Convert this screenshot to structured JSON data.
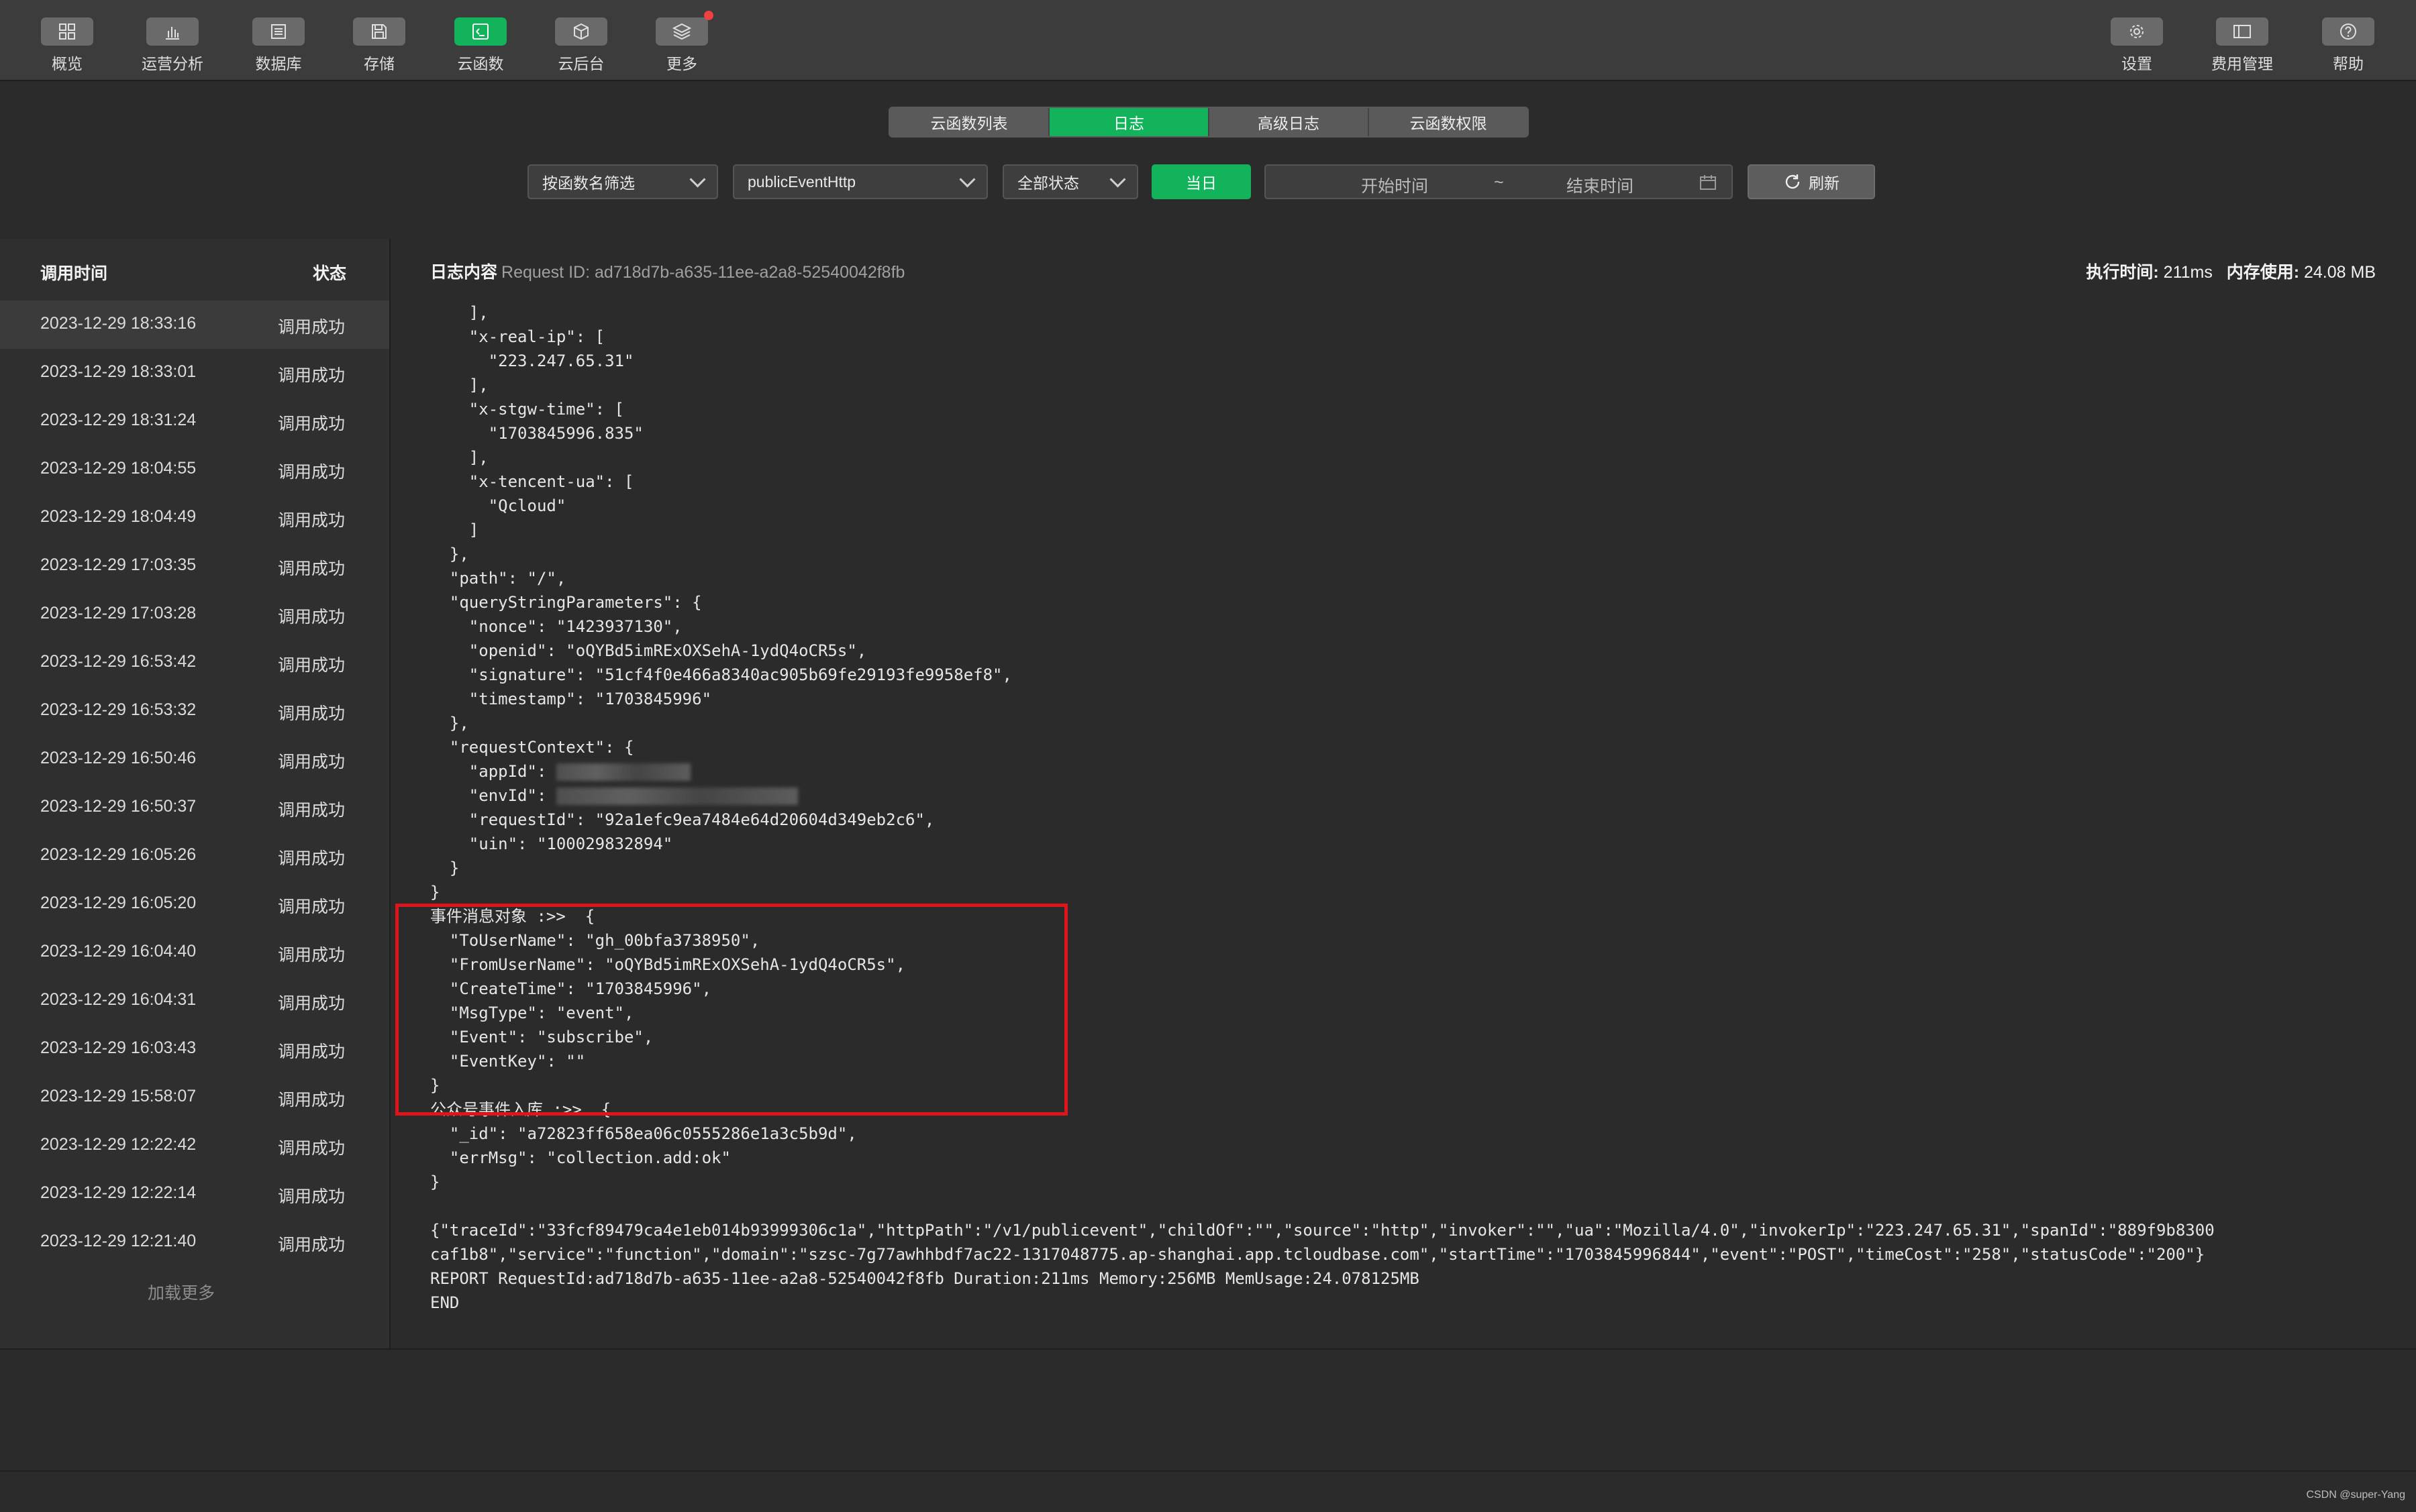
{
  "toolbar": {
    "left_items": [
      {
        "label": "概览",
        "icon": "grid-icon"
      },
      {
        "label": "运营分析",
        "icon": "bar-chart-icon"
      },
      {
        "label": "数据库",
        "icon": "database-icon"
      },
      {
        "label": "存储",
        "icon": "storage-icon"
      },
      {
        "label": "云函数",
        "icon": "cloud-function-icon",
        "active": true
      },
      {
        "label": "云后台",
        "icon": "cube-icon"
      },
      {
        "label": "更多",
        "icon": "layers-icon"
      }
    ],
    "right_items": [
      {
        "label": "设置",
        "icon": "gear-icon"
      },
      {
        "label": "费用管理",
        "icon": "billing-icon"
      },
      {
        "label": "帮助",
        "icon": "help-icon"
      }
    ]
  },
  "tabs": [
    {
      "label": "云函数列表"
    },
    {
      "label": "日志",
      "active": true
    },
    {
      "label": "高级日志"
    },
    {
      "label": "云函数权限"
    }
  ],
  "filters": {
    "function_filter": "按函数名筛选",
    "function_name": "publicEventHttp",
    "status": "全部状态",
    "today_button": "当日",
    "start_time_placeholder": "开始时间",
    "range_separator": "~",
    "end_time_placeholder": "结束时间",
    "refresh_button": "刷新"
  },
  "invocation_list": {
    "col_time": "调用时间",
    "col_status": "状态",
    "rows": [
      {
        "time": "2023-12-29 18:33:16",
        "status": "调用成功"
      },
      {
        "time": "2023-12-29 18:33:01",
        "status": "调用成功"
      },
      {
        "time": "2023-12-29 18:31:24",
        "status": "调用成功"
      },
      {
        "time": "2023-12-29 18:04:55",
        "status": "调用成功"
      },
      {
        "time": "2023-12-29 18:04:49",
        "status": "调用成功"
      },
      {
        "time": "2023-12-29 17:03:35",
        "status": "调用成功"
      },
      {
        "time": "2023-12-29 17:03:28",
        "status": "调用成功"
      },
      {
        "time": "2023-12-29 16:53:42",
        "status": "调用成功"
      },
      {
        "time": "2023-12-29 16:53:32",
        "status": "调用成功"
      },
      {
        "time": "2023-12-29 16:50:46",
        "status": "调用成功"
      },
      {
        "time": "2023-12-29 16:50:37",
        "status": "调用成功"
      },
      {
        "time": "2023-12-29 16:05:26",
        "status": "调用成功"
      },
      {
        "time": "2023-12-29 16:05:20",
        "status": "调用成功"
      },
      {
        "time": "2023-12-29 16:04:40",
        "status": "调用成功"
      },
      {
        "time": "2023-12-29 16:04:31",
        "status": "调用成功"
      },
      {
        "time": "2023-12-29 16:03:43",
        "status": "调用成功"
      },
      {
        "time": "2023-12-29 15:58:07",
        "status": "调用成功"
      },
      {
        "time": "2023-12-29 12:22:42",
        "status": "调用成功"
      },
      {
        "time": "2023-12-29 12:22:14",
        "status": "调用成功"
      },
      {
        "time": "2023-12-29 12:21:40",
        "status": "调用成功"
      }
    ],
    "load_more": "加载更多"
  },
  "log": {
    "heading": "日志内容",
    "request_id": "Request ID: ad718d7b-a635-11ee-a2a8-52540042f8fb",
    "exec_time_label": "执行时间:",
    "exec_time_value": "211ms",
    "memory_label": "内存使用:",
    "memory_value": "24.08 MB",
    "lines": {
      "l01": "    ],",
      "l02": "    \"x-real-ip\": [",
      "l03": "      \"223.247.65.31\"",
      "l04": "    ],",
      "l05": "    \"x-stgw-time\": [",
      "l06": "      \"1703845996.835\"",
      "l07": "    ],",
      "l08": "    \"x-tencent-ua\": [",
      "l09": "      \"Qcloud\"",
      "l10": "    ]",
      "l11": "  },",
      "l12": "  \"path\": \"/\",",
      "l13": "  \"queryStringParameters\": {",
      "l14": "    \"nonce\": \"1423937130\",",
      "l15": "    \"openid\": \"oQYBd5imRExOXSehA-1ydQ4oCR5s\",",
      "l16": "    \"signature\": \"51cf4f0e466a8340ac905b69fe29193fe9958ef8\",",
      "l17": "    \"timestamp\": \"1703845996\"",
      "l18": "  },",
      "l19": "  \"requestContext\": {",
      "l20a": "    \"appId\": ",
      "l21a": "    \"envId\": ",
      "l22": "    \"requestId\": \"92a1efc9ea7484e64d20604d349eb2c6\",",
      "l23": "    \"uin\": \"100029832894\"",
      "l24": "  }",
      "l25": "}",
      "l26": "事件消息对象 :>>  {",
      "l27": "  \"ToUserName\": \"gh_00bfa3738950\",",
      "l28": "  \"FromUserName\": \"oQYBd5imRExOXSehA-1ydQ4oCR5s\",",
      "l29": "  \"CreateTime\": \"1703845996\",",
      "l30": "  \"MsgType\": \"event\",",
      "l31": "  \"Event\": \"subscribe\",",
      "l32": "  \"EventKey\": \"\"",
      "l33": "}",
      "l34": "公众号事件入库 :>>  {",
      "l35": "  \"_id\": \"a72823ff658ea06c0555286e1a3c5b9d\",",
      "l36": "  \"errMsg\": \"collection.add:ok\"",
      "l37": "}",
      "l38": "",
      "l39": "{\"traceId\":\"33fcf89479ca4e1eb014b93999306c1a\",\"httpPath\":\"/v1/publicevent\",\"childOf\":\"\",\"source\":\"http\",\"invoker\":\"\",\"ua\":\"Mozilla/4.0\",\"invokerIp\":\"223.247.65.31\",\"spanId\":\"889f9b8300",
      "l40": "caf1b8\",\"service\":\"function\",\"domain\":\"szsc-7g77awhhbdf7ac22-1317048775.ap-shanghai.app.tcloudbase.com\",\"startTime\":\"1703845996844\",\"event\":\"POST\",\"timeCost\":\"258\",\"statusCode\":\"200\"}",
      "l41": "REPORT RequestId:ad718d7b-a635-11ee-a2a8-52540042f8fb Duration:211ms Memory:256MB MemUsage:24.078125MB",
      "l42": "END"
    }
  },
  "watermark": "CSDN @super-Yang",
  "colors": {
    "accent_green": "#12b35a",
    "highlight_red": "#e0141b",
    "background": "#2b2b2b"
  }
}
